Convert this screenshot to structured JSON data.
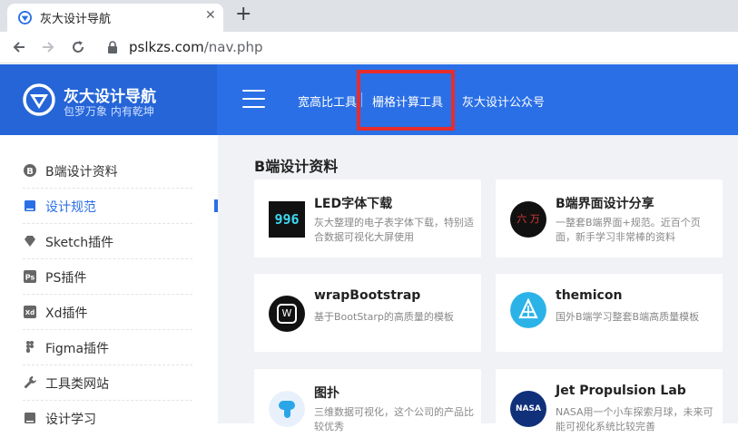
{
  "browser": {
    "tab_title": "灰大设计导航",
    "new_tab": "+",
    "close": "✕",
    "url_host": "pslkzs.com",
    "url_path": "/nav.php"
  },
  "header": {
    "brand_name": "灰大设计导航",
    "brand_sub": "包罗万象 内有乾坤",
    "nav": [
      "宽高比工具",
      "栅格计算工具",
      "灰大设计公众号"
    ],
    "accent": "#2a6fe6",
    "highlight_color": "#e62d2d"
  },
  "sidebar": {
    "items": [
      {
        "label": "B端设计资料",
        "icon": "b-circle-icon"
      },
      {
        "label": "设计规范",
        "icon": "book-icon",
        "active": true
      },
      {
        "label": "Sketch插件",
        "icon": "diamond-icon"
      },
      {
        "label": "PS插件",
        "icon": "ps-icon"
      },
      {
        "label": "Xd插件",
        "icon": "xd-icon"
      },
      {
        "label": "Figma插件",
        "icon": "figma-icon"
      },
      {
        "label": "工具类网站",
        "icon": "wrench-icon"
      },
      {
        "label": "设计学习",
        "icon": "book-icon"
      }
    ]
  },
  "main": {
    "section_title": "B端设计资料",
    "cards": [
      {
        "title": "LED字体下载",
        "desc": "灰大整理的电子表字体下载，特别适合数据可视化大屏使用",
        "icon_text": "996"
      },
      {
        "title": "B端界面设计分享",
        "desc": "一整套B端界面+规范。近百个页面，新手学习非常棒的资料",
        "icon_text": "六 万"
      },
      {
        "title": "wrapBootstrap",
        "desc": "基于BootStarp的高质量的模板",
        "icon_text": "W"
      },
      {
        "title": "themicon",
        "desc": "国外B端学习整套B端高质量模板",
        "icon_text": ""
      },
      {
        "title": "图扑",
        "desc": "三维数据可视化，这个公司的产品比较优秀",
        "icon_text": ""
      },
      {
        "title": "Jet Propulsion Lab",
        "desc": "NASA用一个小车探索月球，未来可能可视化系统比较完善",
        "icon_text": "NASA"
      }
    ]
  }
}
